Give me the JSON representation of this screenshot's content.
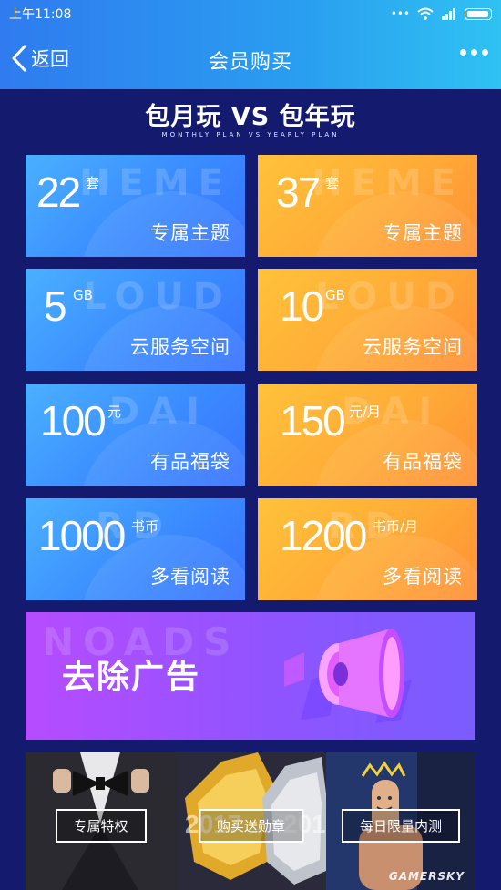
{
  "status_bar": {
    "time": "上午11:08"
  },
  "nav": {
    "back_label": "返回",
    "title": "会员购买"
  },
  "hero": {
    "title": "包月玩 VS 包年玩",
    "subtitle": "MONTHLY PLAN VS YEARLY PLAN"
  },
  "cards": [
    {
      "value": "22",
      "unit": "套",
      "label": "专属主题",
      "ghost": "HEME"
    },
    {
      "value": "37",
      "unit": "套",
      "label": "专属主题",
      "ghost": "HEME"
    },
    {
      "value": "5",
      "unit": "GB",
      "label": "云服务空间",
      "ghost": "LOUD"
    },
    {
      "value": "10",
      "unit": "GB",
      "label": "云服务空间",
      "ghost": "LOUD"
    },
    {
      "value": "100",
      "unit": "元",
      "label": "有品福袋",
      "ghost": "DAI"
    },
    {
      "value": "150",
      "unit": "元/月",
      "label": "有品福袋",
      "ghost": "DAI"
    },
    {
      "value": "1000",
      "unit": "书币",
      "label": "多看阅读",
      "ghost": "RD"
    },
    {
      "value": "1200",
      "unit": "书币/月",
      "label": "多看阅读",
      "ghost": "RD"
    }
  ],
  "noads": {
    "label": "去除广告",
    "ghost": "NOADS"
  },
  "features": [
    {
      "label": "专属特权"
    },
    {
      "label": "购买送勋章"
    },
    {
      "label": "每日限量内测"
    }
  ],
  "watermark": "GAMERSKY",
  "colors": {
    "blue_card": "#3b8cff",
    "orange_card": "#ffab37",
    "background": "#141a6e",
    "noads": "#9a52ff"
  }
}
